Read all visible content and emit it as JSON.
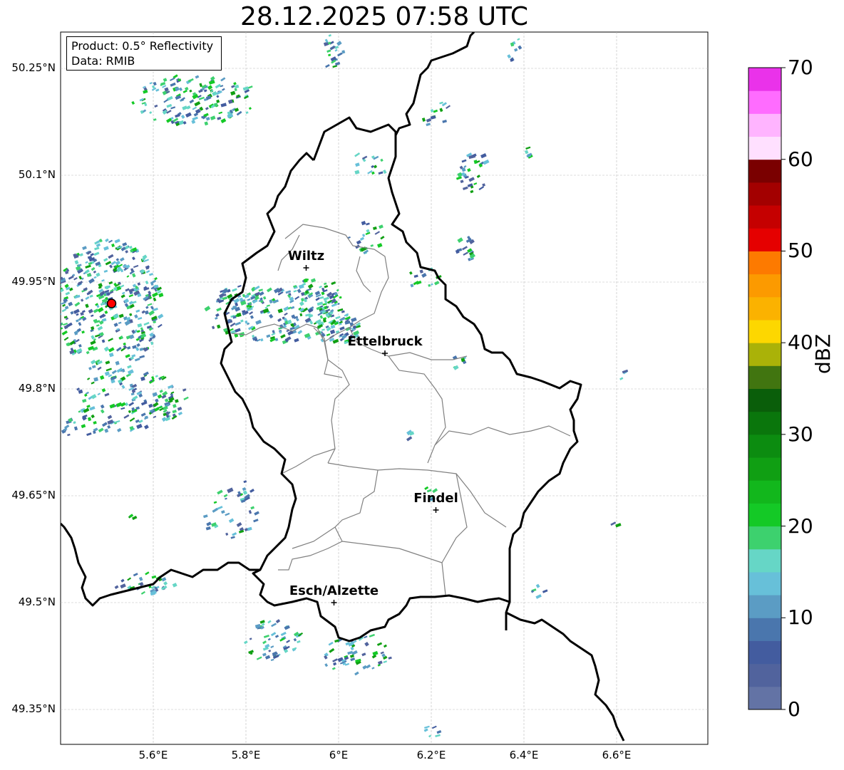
{
  "title": "28.12.2025 07:58 UTC",
  "info_box": {
    "product": "Product: 0.5° Reflectivity",
    "data_source": "Data: RMIB"
  },
  "lat_ticks": [
    "50.25°N",
    "50.1°N",
    "49.95°N",
    "49.8°N",
    "49.65°N",
    "49.5°N",
    "49.35°N"
  ],
  "lon_ticks": [
    "5.6°E",
    "5.8°E",
    "6°E",
    "6.2°E",
    "6.4°E",
    "6.6°E"
  ],
  "cities": [
    {
      "name": "Wiltz",
      "lon": 5.93,
      "lat": 49.97
    },
    {
      "name": "Ettelbruck",
      "lon": 6.1,
      "lat": 49.85
    },
    {
      "name": "Findel",
      "lon": 6.21,
      "lat": 49.63
    },
    {
      "name": "Esch/Alzette",
      "lon": 5.99,
      "lat": 49.5
    }
  ],
  "radar_site": {
    "lon": 5.51,
    "lat": 49.92
  },
  "colorbar": {
    "label": "dBZ",
    "ticks": [
      "0",
      "10",
      "20",
      "30",
      "40",
      "50",
      "60",
      "70"
    ],
    "colors": [
      "#6373a5",
      "#51639d",
      "#435c9f",
      "#4a76ad",
      "#5b9cc4",
      "#67c0d9",
      "#66d6c6",
      "#3dd16e",
      "#14c926",
      "#12b71c",
      "#109f13",
      "#0c8c10",
      "#0a760c",
      "#0a5e0a",
      "#417510",
      "#aab208",
      "#fdd700",
      "#fbb200",
      "#fc9a00",
      "#fd7a00",
      "#e50000",
      "#c50000",
      "#a30000",
      "#7a0000",
      "#ffe0ff",
      "#ffb4ff",
      "#ff6cff",
      "#ea32ea"
    ]
  },
  "colors": {
    "border": "#000000",
    "district": "#808080",
    "grid": "#bbbbbb",
    "radar_marker": "#ff0000"
  }
}
